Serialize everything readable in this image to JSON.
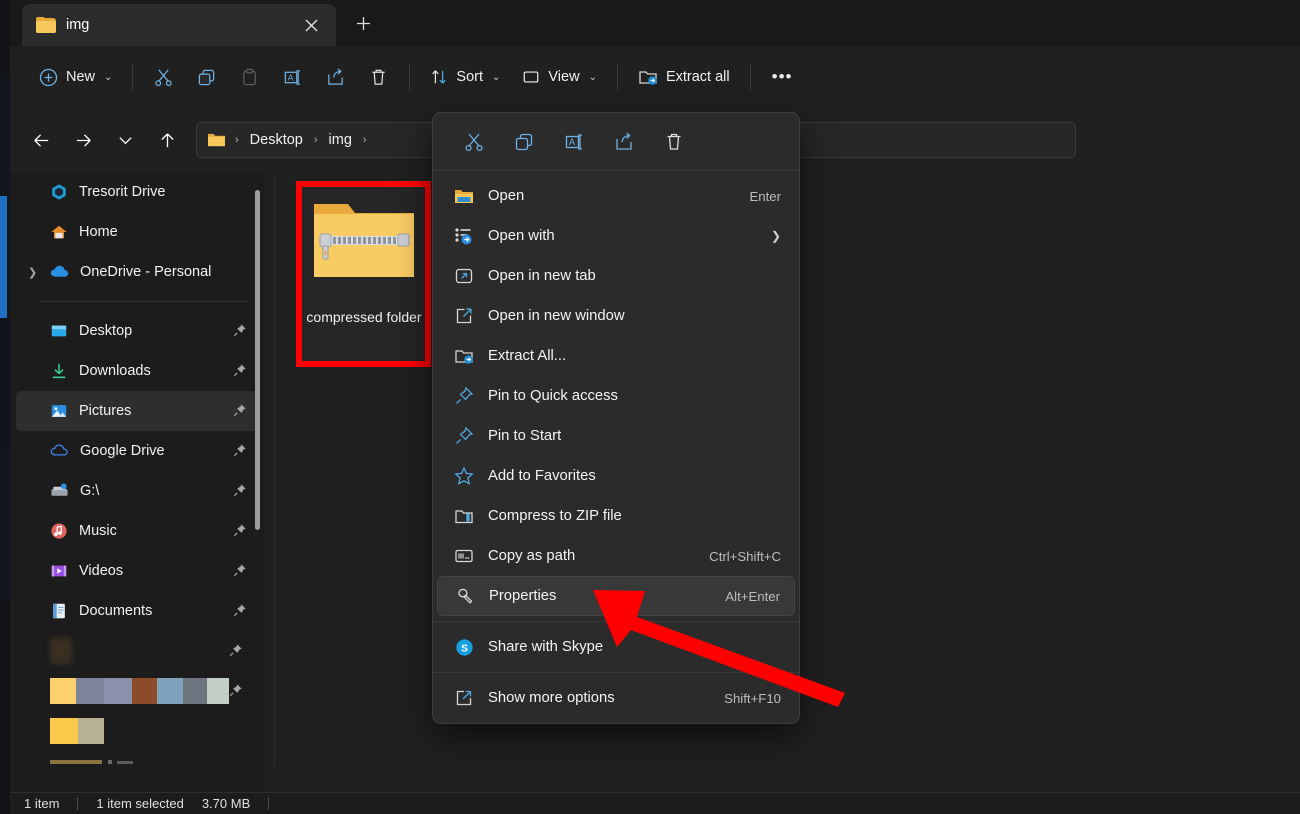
{
  "window": {
    "tab": {
      "title": "img",
      "folder_icon": "folder-icon",
      "close_icon": "close-icon"
    },
    "new_tab_label": "+"
  },
  "command_bar": {
    "new_label": "New",
    "new_icon": "plus-circle-icon",
    "cut_icon": "scissors-icon",
    "copy_icon": "copy-icon",
    "paste_icon": "paste-icon",
    "rename_icon": "rename-icon",
    "share_icon": "share-icon",
    "delete_icon": "trash-icon",
    "sort_label": "Sort",
    "sort_icon": "sort-icon",
    "view_label": "View",
    "view_icon": "view-icon",
    "extract_all_label": "Extract all",
    "extract_all_icon": "extract-folder-icon",
    "more_label": "•••"
  },
  "address_bar": {
    "back_icon": "arrow-left-icon",
    "forward_icon": "arrow-right-icon",
    "recent_icon": "chevron-down-icon",
    "up_icon": "arrow-up-icon",
    "crumbs": [
      "Desktop",
      "img"
    ],
    "separator": "›",
    "root_icon": "folder-icon"
  },
  "sidebar": {
    "groups": [
      {
        "items": [
          {
            "label": "Tresorit Drive",
            "icon": "tresorit-icon",
            "pinned": false,
            "expandable": false,
            "selected": false
          },
          {
            "label": "Home",
            "icon": "home-icon",
            "pinned": false,
            "expandable": false,
            "selected": false
          },
          {
            "label": "OneDrive - Personal",
            "icon": "onedrive-icon",
            "pinned": false,
            "expandable": true,
            "selected": false
          }
        ]
      },
      {
        "items": [
          {
            "label": "Desktop",
            "icon": "desktop-icon",
            "pinned": true,
            "expandable": false,
            "selected": false
          },
          {
            "label": "Downloads",
            "icon": "downloads-icon",
            "pinned": true,
            "expandable": false,
            "selected": false
          },
          {
            "label": "Pictures",
            "icon": "pictures-icon",
            "pinned": true,
            "expandable": false,
            "selected": true
          },
          {
            "label": "Google Drive",
            "icon": "google-drive-icon",
            "pinned": true,
            "expandable": false,
            "selected": false
          },
          {
            "label": "G:\\",
            "icon": "network-drive-icon",
            "pinned": true,
            "expandable": false,
            "selected": false
          },
          {
            "label": "Music",
            "icon": "music-icon",
            "pinned": true,
            "expandable": false,
            "selected": false
          },
          {
            "label": "Videos",
            "icon": "videos-icon",
            "pinned": true,
            "expandable": false,
            "selected": false
          },
          {
            "label": "Documents",
            "icon": "documents-icon",
            "pinned": true,
            "expandable": false,
            "selected": false
          },
          {
            "label": "",
            "icon": "redacted-icon",
            "pinned": true,
            "expandable": false,
            "selected": false,
            "redacted": true
          },
          {
            "label": "",
            "icon": "redacted-icon",
            "pinned": true,
            "expandable": false,
            "selected": false,
            "redacted": true
          },
          {
            "label": "",
            "icon": "redacted-icon",
            "pinned": false,
            "expandable": false,
            "selected": false,
            "redacted": true
          }
        ]
      }
    ],
    "pin_glyph": "📌"
  },
  "content": {
    "items": [
      {
        "name": "compressed folder",
        "icon": "zipped-folder-icon",
        "highlighted": true
      }
    ]
  },
  "status_bar": {
    "item_count": "1 item",
    "selected_count": "1 item selected",
    "size": "3.70 MB"
  },
  "context_menu": {
    "toolbar": [
      {
        "icon": "scissors-icon",
        "name": "cut"
      },
      {
        "icon": "copy-icon",
        "name": "copy"
      },
      {
        "icon": "rename-icon",
        "name": "rename"
      },
      {
        "icon": "share-icon",
        "name": "share"
      },
      {
        "icon": "trash-icon",
        "name": "delete"
      }
    ],
    "items": [
      {
        "label": "Open",
        "icon": "folder-open-icon",
        "accel": "Enter",
        "submenu": false,
        "hover": false,
        "divider_before": false
      },
      {
        "label": "Open with",
        "icon": "open-with-icon",
        "accel": "",
        "submenu": true,
        "hover": false,
        "divider_before": false
      },
      {
        "label": "Open in new tab",
        "icon": "new-tab-icon",
        "accel": "",
        "submenu": false,
        "hover": false,
        "divider_before": false
      },
      {
        "label": "Open in new window",
        "icon": "new-window-icon",
        "accel": "",
        "submenu": false,
        "hover": false,
        "divider_before": false
      },
      {
        "label": "Extract All...",
        "icon": "extract-folder-icon",
        "accel": "",
        "submenu": false,
        "hover": false,
        "divider_before": false
      },
      {
        "label": "Pin to Quick access",
        "icon": "pin-icon",
        "accel": "",
        "submenu": false,
        "hover": false,
        "divider_before": false
      },
      {
        "label": "Pin to Start",
        "icon": "pin-icon",
        "accel": "",
        "submenu": false,
        "hover": false,
        "divider_before": false
      },
      {
        "label": "Add to Favorites",
        "icon": "star-icon",
        "accel": "",
        "submenu": false,
        "hover": false,
        "divider_before": false
      },
      {
        "label": "Compress to ZIP file",
        "icon": "compress-zip-icon",
        "accel": "",
        "submenu": false,
        "hover": false,
        "divider_before": false
      },
      {
        "label": "Copy as path",
        "icon": "copy-path-icon",
        "accel": "Ctrl+Shift+C",
        "submenu": false,
        "hover": false,
        "divider_before": false
      },
      {
        "label": "Properties",
        "icon": "wrench-icon",
        "accel": "Alt+Enter",
        "submenu": false,
        "hover": true,
        "divider_before": false
      },
      {
        "label": "Share with Skype",
        "icon": "skype-icon",
        "accel": "",
        "submenu": false,
        "hover": false,
        "divider_before": true
      },
      {
        "label": "Show more options",
        "icon": "show-more-icon",
        "accel": "Shift+F10",
        "submenu": false,
        "hover": false,
        "divider_before": true
      }
    ]
  },
  "annotation": {
    "arrow_color": "#ff0000",
    "highlight_color": "#ff0000"
  }
}
